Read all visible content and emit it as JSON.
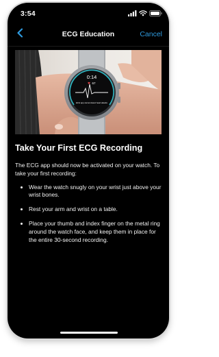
{
  "status_bar": {
    "time": "3:54"
  },
  "nav": {
    "title": "ECG Education",
    "cancel_label": "Cancel",
    "back_icon": "chevron-left-icon"
  },
  "hero": {
    "watch_time": "0:14",
    "heart_rate": "67",
    "watch_message": "ECG app cannot detect heart attacks"
  },
  "content": {
    "heading": "Take Your First ECG Recording",
    "intro": "The ECG app should now be activated on your watch. To take your first recording:",
    "steps": [
      "Wear the watch snugly on your wrist just above your wrist bones.",
      "Rest your arm and wrist on a table.",
      "Place your thumb and index finger on the metal ring around the watch face, and keep them in place for the entire 30-second recording."
    ]
  },
  "colors": {
    "background": "#000000",
    "accent": "#2f9bdf",
    "text": "#ffffff"
  }
}
